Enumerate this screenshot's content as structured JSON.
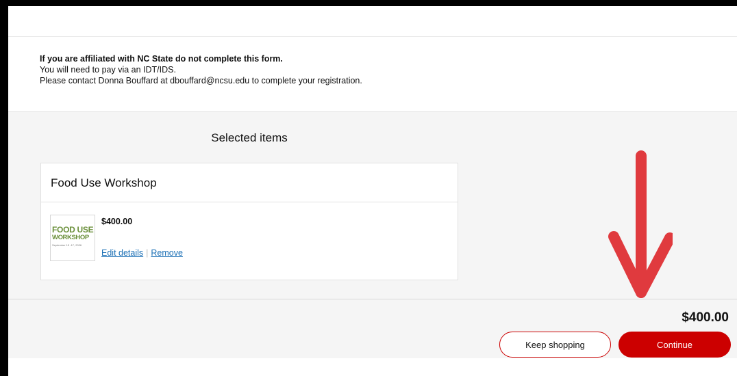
{
  "notice": {
    "line1": "If you are affiliated with NC State do not complete this form.",
    "line2": "You will need to pay via an IDT/IDS.",
    "line3": "Please contact Donna Bouffard at dbouffard@ncsu.edu to complete your registration."
  },
  "cart": {
    "heading": "Selected items",
    "item": {
      "title": "Food Use Workshop",
      "thumbnail": {
        "line1": "FOOD USE",
        "line2": "WORKSHOP",
        "line3": "September 15 -17, 2026"
      },
      "price": "$400.00",
      "edit_label": "Edit details",
      "separator": "|",
      "remove_label": "Remove"
    },
    "total": "$400.00"
  },
  "actions": {
    "keep_shopping_label": "Keep shopping",
    "continue_label": "Continue"
  },
  "colors": {
    "accent": "#cc0000",
    "link": "#1a6fb5",
    "annotation_arrow": "#e03a3e"
  },
  "icons": {
    "annotation": "down-arrow-annotation"
  }
}
